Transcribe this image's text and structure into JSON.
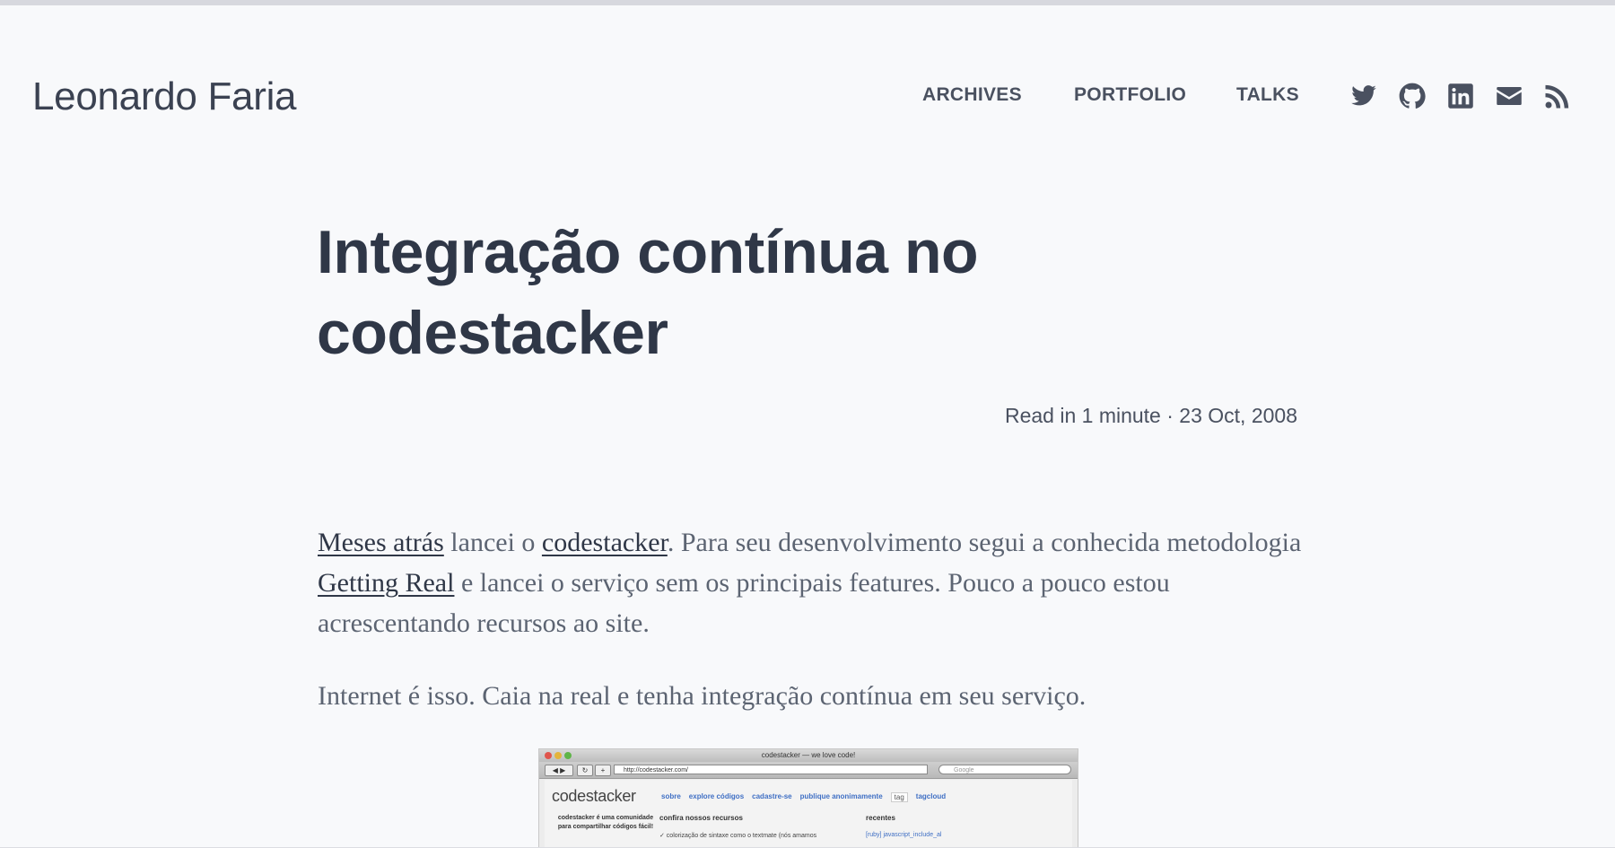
{
  "header": {
    "site_title": "Leonardo Faria",
    "nav": [
      {
        "label": "ARCHIVES"
      },
      {
        "label": "PORTFOLIO"
      },
      {
        "label": "TALKS"
      }
    ],
    "social_icons": [
      "twitter-icon",
      "github-icon",
      "linkedin-icon",
      "mail-icon",
      "rss-icon"
    ]
  },
  "post": {
    "title": "Integração contínua no codestacker",
    "meta": "Read in 1 minute · 23 Oct, 2008",
    "p1": {
      "link1": "Meses atrás",
      "t1": " lancei o ",
      "link2": "codestacker",
      "t2": ". Para seu desenvolvimento segui a conhecida metodologia ",
      "link3": "Getting Real",
      "t3": " e lancei o serviço sem os principais features. Pouco a pouco estou acrescentando recursos ao site."
    },
    "p2": "Internet é isso. Caia na real e tenha integração contínua em seu serviço."
  },
  "screenshot": {
    "window_title": "codestacker — we love code!",
    "url": "http://codestacker.com/",
    "search_placeholder": "Google",
    "logo": "codestacker",
    "links": [
      "sobre",
      "explore códigos",
      "cadastre-se",
      "publique anonimamente",
      "tag",
      "tagcloud"
    ],
    "side_text": "codestacker é uma comunidade para compartilhar códigos fácil!",
    "section1": "confira nossos recursos",
    "section2": "recentes",
    "item1": "✓ colorização de sintaxe como o textmate (nós amamos",
    "recent1": "[ruby] javascript_include_al"
  },
  "colors": {
    "background": "#f8f9fb",
    "text": "#2f3747",
    "muted": "#5c6472",
    "link_blue": "#3f6fc4"
  }
}
